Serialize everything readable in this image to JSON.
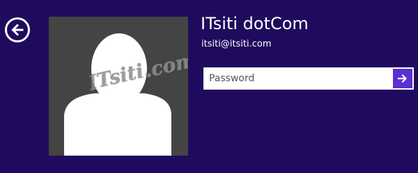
{
  "user": {
    "name": "ITsiti dotCom",
    "email": "itsiti@itsiti.com"
  },
  "avatar": {
    "watermark": "ITsiti.com"
  },
  "password_field": {
    "value": "",
    "placeholder": "Password"
  },
  "icons": {
    "back": "back-arrow-icon",
    "submit": "arrow-right-icon"
  },
  "colors": {
    "background": "#1f0a5e",
    "accent": "#5b2fd0",
    "avatar_tile": "#444444"
  }
}
